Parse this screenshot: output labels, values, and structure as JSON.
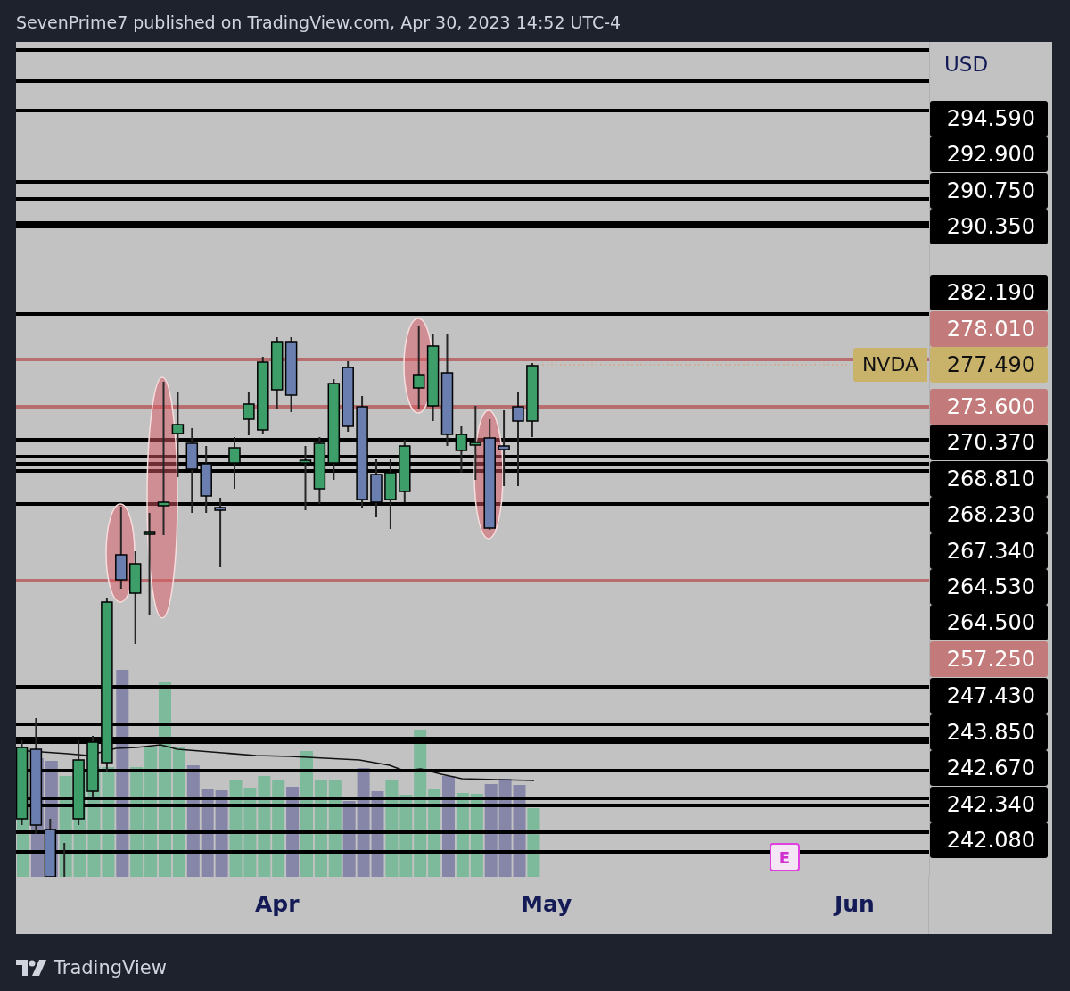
{
  "header": {
    "text": "SevenPrime7 published on TradingView.com, Apr 30, 2023 14:52 UTC-4"
  },
  "chart": {
    "symbol_tag": {
      "text": "NVDA",
      "color": "#c9b36a"
    },
    "earnings_marker": "E"
  },
  "price_axis": {
    "currency": "USD",
    "labels": [
      {
        "text": "294.590",
        "color": "#000000"
      },
      {
        "text": "292.900",
        "color": "#000000"
      },
      {
        "text": "290.750",
        "color": "#000000"
      },
      {
        "text": "290.350",
        "color": "#000000"
      },
      {
        "text": "282.190",
        "color": "#000000"
      },
      {
        "text": "278.010",
        "color": "#c27a7a"
      },
      {
        "text": "277.490",
        "color": "#c9b36a"
      },
      {
        "text": "273.600",
        "color": "#c27a7a"
      },
      {
        "text": "270.370",
        "color": "#000000"
      },
      {
        "text": "268.810",
        "color": "#000000"
      },
      {
        "text": "268.230",
        "color": "#000000"
      },
      {
        "text": "267.340",
        "color": "#000000"
      },
      {
        "text": "264.530",
        "color": "#000000"
      },
      {
        "text": "264.500",
        "color": "#000000"
      },
      {
        "text": "257.250",
        "color": "#c27a7a"
      },
      {
        "text": "247.430",
        "color": "#000000"
      },
      {
        "text": "243.850",
        "color": "#000000"
      },
      {
        "text": "242.670",
        "color": "#000000"
      },
      {
        "text": "242.340",
        "color": "#000000"
      },
      {
        "text": "242.080",
        "color": "#000000"
      }
    ]
  },
  "time_axis": {
    "labels": [
      "Apr",
      "May",
      "Jun"
    ]
  },
  "footer": {
    "brand": "TradingView"
  }
}
